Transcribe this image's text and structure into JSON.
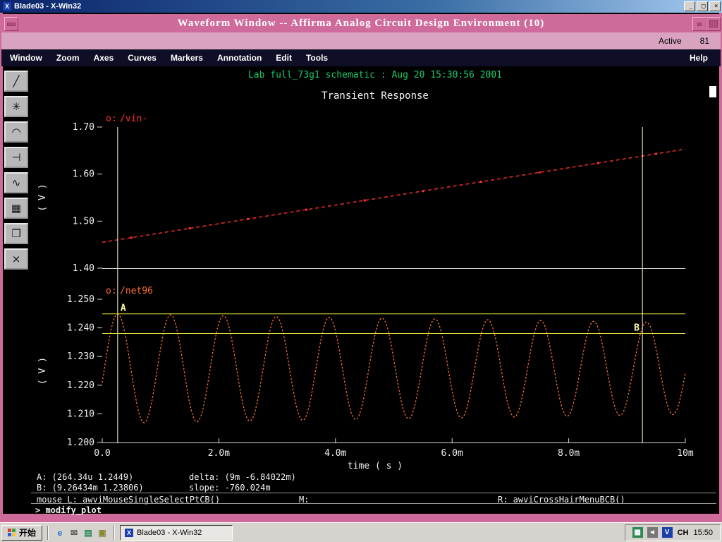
{
  "window": {
    "os_title": "Blade03 - X-Win32",
    "title": "Waveform Window -- Affirma Analog Circuit Design Environment (10)",
    "active_label": "Active",
    "active_value": "81",
    "minimize": "_",
    "maximize": "□",
    "close": "×"
  },
  "menubar": {
    "items": [
      "Window",
      "Zoom",
      "Axes",
      "Curves",
      "Markers",
      "Annotation",
      "Edit",
      "Tools"
    ],
    "help": "Help"
  },
  "toolbar": {
    "buttons": [
      {
        "name": "pencil-probe-icon",
        "glyph": "╱"
      },
      {
        "name": "crosshair-star-icon",
        "glyph": "✳"
      },
      {
        "name": "arc-tool-icon",
        "glyph": "◠"
      },
      {
        "name": "marker-tool-icon",
        "glyph": "⊣"
      },
      {
        "name": "wave-marker-icon",
        "glyph": "∿"
      },
      {
        "name": "calculator-icon",
        "glyph": "▦"
      },
      {
        "name": "copy-graph-icon",
        "glyph": "❐"
      },
      {
        "name": "delete-tool-icon",
        "glyph": "×"
      }
    ]
  },
  "chart_data": [
    {
      "type": "line",
      "subtitle": "Lab full_73g1 schematic : Aug 20 15:30:56 2001",
      "title": "Transient Response",
      "ylabel": "( V )",
      "ylim": [
        1.4,
        1.7
      ],
      "yticks": [
        "1.70",
        "1.60",
        "1.50",
        "1.40"
      ],
      "legend_prefix": "o:",
      "series": [
        {
          "name": "/vin-",
          "color": "#ff3030",
          "style": "dashed",
          "x_s": [
            0,
            0.01
          ],
          "v": [
            1.455,
            1.653
          ]
        }
      ]
    },
    {
      "type": "line",
      "ylabel": "( V )",
      "ylim": [
        1.2,
        1.25
      ],
      "yticks": [
        "1.250",
        "1.240",
        "1.230",
        "1.220",
        "1.210",
        "1.200"
      ],
      "xlim_s": [
        0,
        0.01
      ],
      "xticks": [
        "0.0",
        "2.0m",
        "4.0m",
        "6.0m",
        "8.0m",
        "10m"
      ],
      "xlabel": "time ( s )",
      "legend_prefix": "o:",
      "series": [
        {
          "name": "/net96",
          "color": "#ff7030",
          "style": "dotted",
          "model": "decaying_sine",
          "offset_v": 1.2258,
          "amp_start_v": 0.0191,
          "amp_end_v": 0.016,
          "period_s": 0.000907,
          "peak_time_s": 0.00026434
        }
      ],
      "markers": [
        {
          "label": "A",
          "t_s": 0.00026434,
          "v": 1.2449
        },
        {
          "label": "B",
          "t_s": 0.00926434,
          "v": 1.23806
        }
      ]
    }
  ],
  "status": {
    "a": "A: (264.34u 1.2449)",
    "delta": "delta: (9m -6.84022m)",
    "b": "B: (9.26434m 1.23806)",
    "slope": "slope: -760.024m",
    "mouse_l": "mouse L: awviMouseSingleSelectPtCB()",
    "mouse_m": "M:",
    "mouse_r": "R: awviCrossHairMenuBCB()",
    "prompt": "> modify_plot"
  },
  "taskbar": {
    "start": "开始",
    "task": "Blade03 - X-Win32",
    "lang": "CH",
    "time": "15:50",
    "quicklaunch": [
      {
        "name": "ie-icon",
        "glyph": "e",
        "color": "#1b6acb"
      },
      {
        "name": "mail-icon",
        "glyph": "✉",
        "color": "#555555"
      },
      {
        "name": "desktop-icon",
        "glyph": "▤",
        "color": "#2a8855"
      },
      {
        "name": "folder-icon",
        "glyph": "▣",
        "color": "#888833"
      }
    ],
    "tray": [
      {
        "name": "display-tray-icon",
        "glyph": "▦",
        "bg": "#2a8855"
      },
      {
        "name": "volume-tray-icon",
        "glyph": "◄",
        "bg": "#777777"
      },
      {
        "name": "antivirus-tray-icon",
        "glyph": "V",
        "bg": "#1b3faa"
      }
    ]
  }
}
